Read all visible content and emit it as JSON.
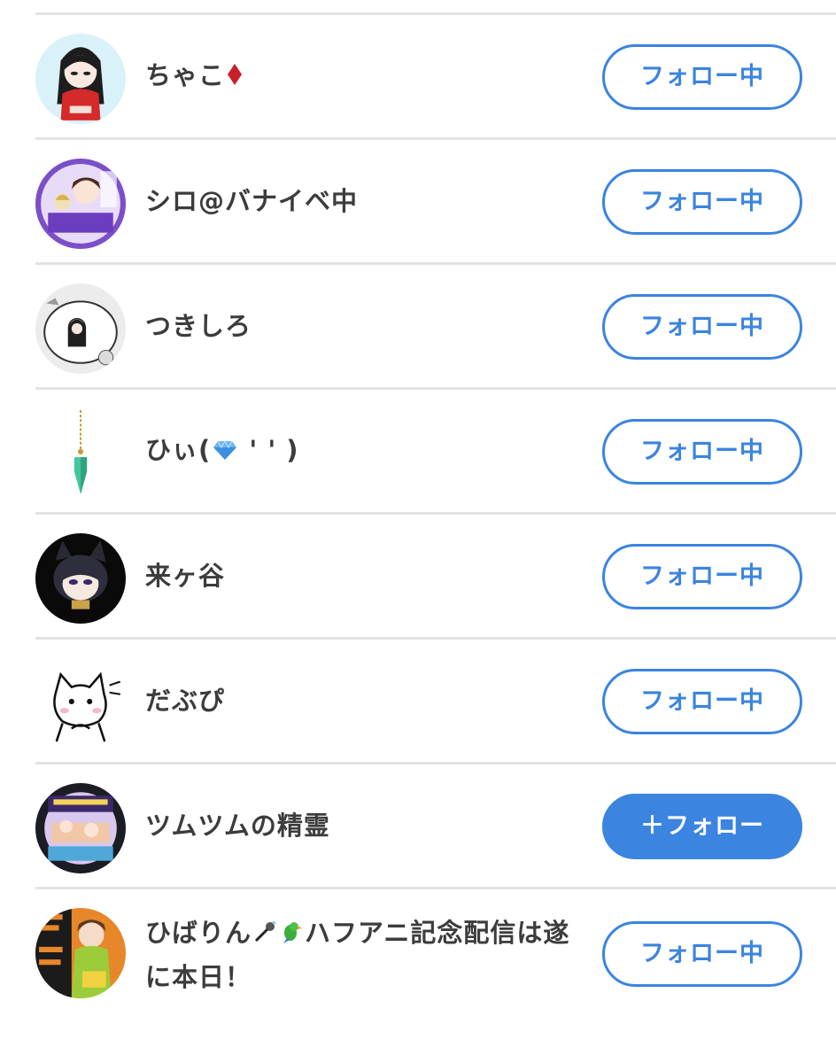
{
  "users": [
    {
      "name": "ちゃこ",
      "emoji": "diamond-red",
      "button": "フォロー中",
      "following": true
    },
    {
      "name": "シロ@バナイベ中",
      "button": "フォロー中",
      "following": true
    },
    {
      "name": "つきしろ",
      "button": "フォロー中",
      "following": true
    },
    {
      "name_prefix": "ひぃ(",
      "emoji": "gem-blue",
      "name_suffix": " ' ' )",
      "button": "フォロー中",
      "following": true
    },
    {
      "name": "来ヶ谷",
      "button": "フォロー中",
      "following": true
    },
    {
      "name": "だぶぴ",
      "button": "フォロー中",
      "following": true
    },
    {
      "name": "ツムツムの精霊",
      "button": "＋フォロー",
      "following": false
    },
    {
      "name_prefix": "ひばりん",
      "emoji": "mic-parrot",
      "name_suffix": "ハフアニ記念配信は遂に本日！",
      "button": "フォロー中",
      "following": true
    }
  ],
  "colors": {
    "accent": "#3b84e0",
    "divider": "#e3e3e3",
    "text": "#3c3c3c"
  }
}
